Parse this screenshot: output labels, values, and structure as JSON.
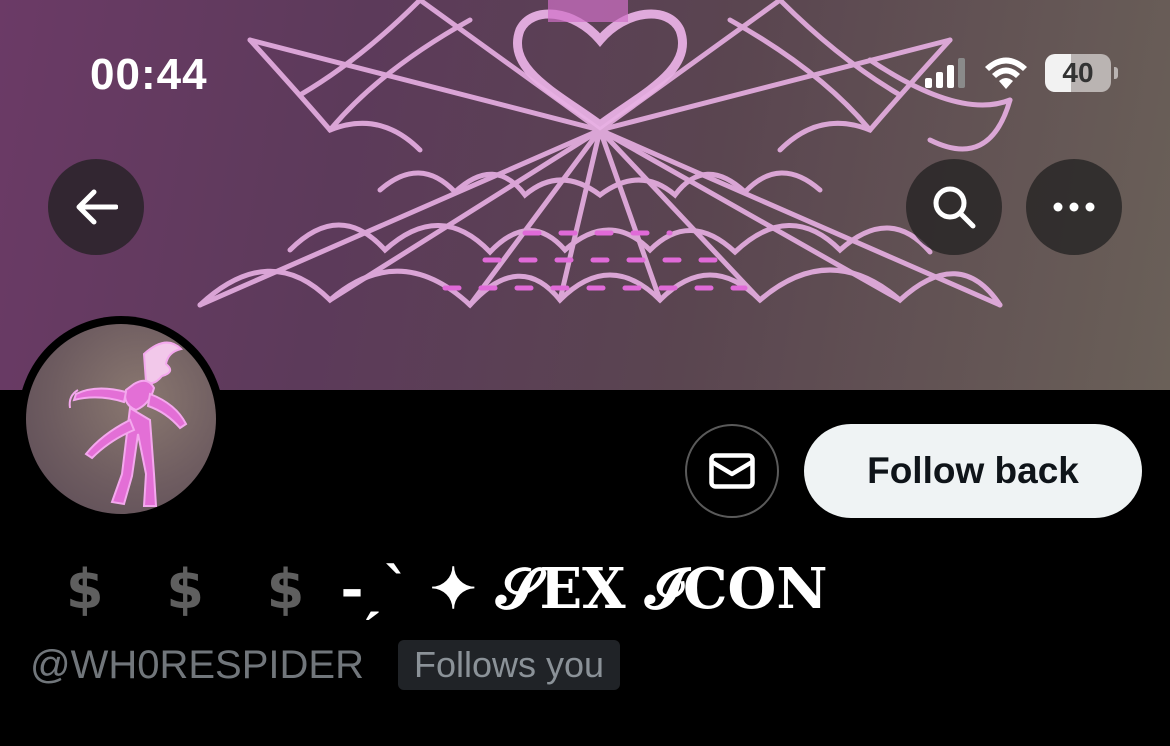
{
  "status_bar": {
    "time": "00:44",
    "battery": "40",
    "battery_level": 0.4,
    "icons": [
      "signal-icon",
      "wifi-icon",
      "battery-icon"
    ]
  },
  "header": {
    "back_icon": "arrow-left-icon",
    "search_icon": "search-icon",
    "more_icon": "more-horizontal-icon"
  },
  "profile": {
    "dollars": "$ $ $",
    "display_name": "-ˏˋ ✦ 𝓢EX 𝓘CON",
    "handle": "@WH0RESPIDER",
    "follows_you": "Follows you"
  },
  "actions": {
    "message_icon": "envelope-icon",
    "follow_back_label": "Follow back"
  },
  "colors": {
    "background": "#000000",
    "follow_button_bg": "#eff3f4",
    "muted_text": "#71767b",
    "web_color": "#e7a6e0"
  }
}
